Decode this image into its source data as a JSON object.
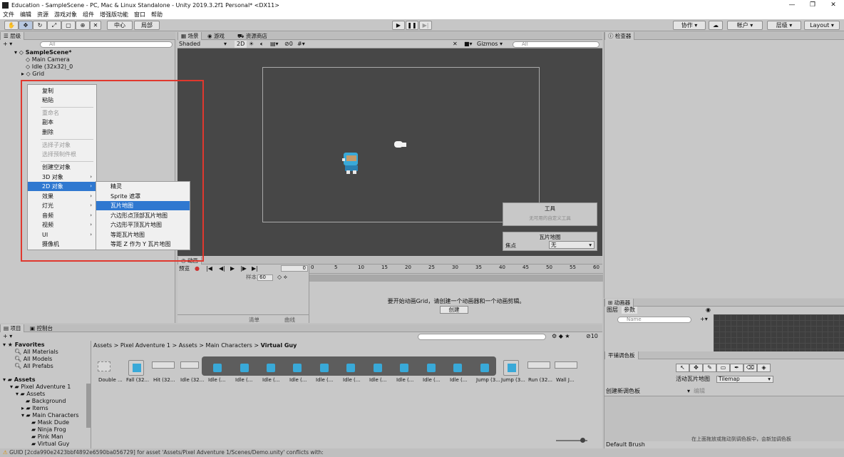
{
  "window": {
    "title": "Education - SampleScene - PC, Mac & Linux Standalone - Unity 2019.3.2f1 Personal* <DX11>",
    "minimize": "—",
    "maximize": "❐",
    "close": "✕"
  },
  "menubar": [
    "文件",
    "编辑",
    "资源",
    "游戏对象",
    "组件",
    "增强版功能",
    "窗口",
    "帮助"
  ],
  "toolbar": {
    "pivot": "中心",
    "local": "局部",
    "collab": "协作",
    "account": "帐户",
    "layers": "层级",
    "layout": "Layout"
  },
  "hierarchy": {
    "tab": "层级",
    "search_placeholder": "All",
    "scene": "SampleScene*",
    "items": [
      "Main Camera",
      "Idle (32x32)_0",
      "Grid"
    ]
  },
  "context_menu": {
    "items": [
      "复制",
      "粘贴",
      "重命名",
      "副本",
      "删除",
      "选择子对象",
      "选择预制件根",
      "创建空对象",
      "3D 对象",
      "2D 对象",
      "效果",
      "灯光",
      "音频",
      "视频",
      "UI",
      "摄像机"
    ],
    "sub_items": [
      "精灵",
      "Sprite 遮罩",
      "瓦片地图",
      "六边形点顶部瓦片地图",
      "六边形平顶瓦片地图",
      "等距瓦片地图",
      "等距 Z 作为 Y 瓦片地图"
    ]
  },
  "scene_view": {
    "tabs": [
      "场景",
      "游戏",
      "资源商店"
    ],
    "shading": "Shaded",
    "mode_2d": "2D",
    "gizmos": "Gizmos",
    "search_placeholder": "All",
    "fx_count": "0"
  },
  "tools_overlay": {
    "title": "工具",
    "subtitle": "无可用的自定义工具"
  },
  "tilemap_overlay": {
    "title": "瓦片地图",
    "focus_label": "焦点",
    "focus_value": "无"
  },
  "animation": {
    "tab": "动画",
    "preview": "预览",
    "frame": "0",
    "samples_label": "样本",
    "samples_value": "60",
    "ticks": [
      "0",
      "5",
      "10",
      "15",
      "20",
      "25",
      "30",
      "35",
      "40",
      "45",
      "50",
      "55",
      "60"
    ],
    "message": "要开始动画Grid，请创建一个动画器和一个动画剪辑。",
    "create_button": "创建",
    "dopesheet": "清单",
    "curves": "曲线"
  },
  "inspector": {
    "tab": "检查器"
  },
  "animator": {
    "tab": "动画器",
    "layers": "图层",
    "params": "参数",
    "search_placeholder": "Name"
  },
  "palette": {
    "tab": "平铺调色板",
    "active_label": "活动瓦片地图",
    "active_value": "Tilemap",
    "create_palette": "创建新调色板",
    "edit": "编辑",
    "brush": "Default Brush",
    "hint": "在上面拖放或拖动到调色板中，会新加调色板"
  },
  "project": {
    "tabs": [
      "项目",
      "控制台"
    ],
    "count": "10",
    "favorites": [
      "Favorites",
      "All Materials",
      "All Models",
      "All Prefabs"
    ],
    "tree": [
      "Assets",
      "Pixel Adventure 1",
      "Assets",
      "Background",
      "Items",
      "Main Characters",
      "Mask Dude",
      "Ninja Frog",
      "Pink Man",
      "Virtual Guy"
    ],
    "breadcrumb": [
      "Assets",
      "Pixel Adventure 1",
      "Assets",
      "Main Characters",
      "Virtual Guy"
    ],
    "thumbs": [
      "Double ...",
      "Fall (32...",
      "Hit (32...",
      "Idle (32...",
      "Idle (...",
      "Idle (...",
      "Idle (...",
      "Idle (...",
      "Idle (...",
      "Idle (...",
      "Idle (...",
      "Idle (...",
      "Idle (...",
      "Idle (...",
      "Jump (3...",
      "Run (32...",
      "Wall J..."
    ]
  },
  "status": "GUID [2cda990e2423bbf4892e6590ba056729] for asset 'Assets/Pixel Adventure 1/Scenes/Demo.unity' conflicts with:",
  "colors": {
    "highlight": "#2f78d0",
    "red_box": "#e0382e",
    "scene_bg": "#474747"
  }
}
